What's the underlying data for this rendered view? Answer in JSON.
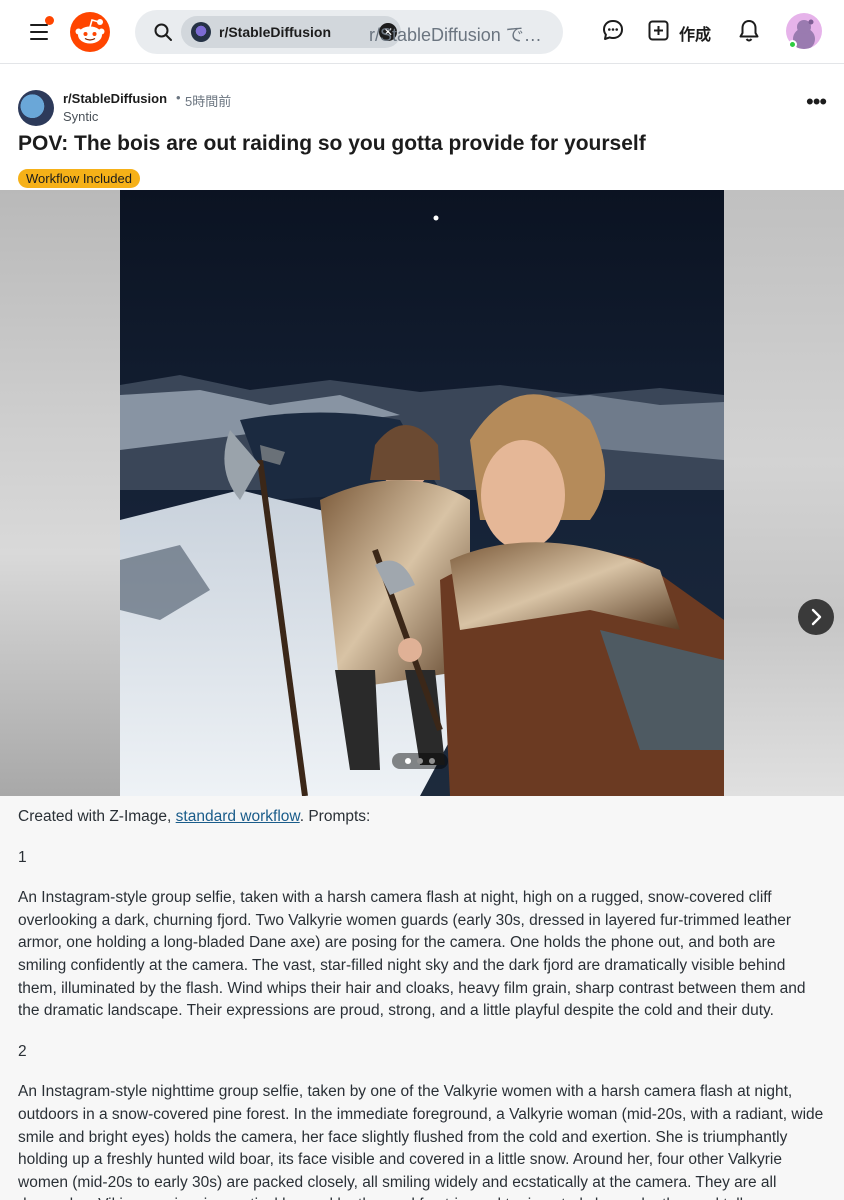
{
  "header": {
    "search": {
      "community_chip": "r/StableDiffusion",
      "placeholder": "r/StableDiffusion で検索"
    },
    "create_label": "作成",
    "icons": [
      "menu-icon",
      "reddit-logo-icon",
      "search-icon",
      "close-icon",
      "chat-icon",
      "plus-icon",
      "bell-icon",
      "avatar"
    ]
  },
  "post": {
    "subreddit": "r/StableDiffusion",
    "separator": "•",
    "time": "5時間前",
    "author": "Syntic",
    "title": "POV: The bois are out raiding so you gotta provide for yourself",
    "flair": "Workflow Included",
    "flair_color": "#f6b118",
    "gallery": {
      "current_index": 1,
      "total": 3
    },
    "body": {
      "intro_prefix": "Created with Z-Image, ",
      "intro_link": "standard workflow",
      "intro_suffix": ". Prompts:",
      "prompt1_number": "1",
      "prompt1_text": "An Instagram-style group selfie, taken with a harsh camera flash at night, high on a rugged, snow-covered cliff overlooking a dark, churning fjord. Two Valkyrie women guards (early 30s, dressed in layered fur-trimmed leather armor, one holding a long-bladed Dane axe) are posing for the camera. One holds the phone out, and both are smiling confidently at the camera. The vast, star-filled night sky and the dark fjord are dramatically visible behind them, illuminated by the flash. Wind whips their hair and cloaks, heavy film grain, sharp contrast between them and the dramatic landscape. Their expressions are proud, strong, and a little playful despite the cold and their duty.",
      "prompt2_number": "2",
      "prompt2_text": "An Instagram-style nighttime group selfie, taken by one of the Valkyrie women with a harsh camera flash at night, outdoors in a snow-covered pine forest. In the immediate foreground, a Valkyrie woman (mid-20s, with a radiant, wide smile and bright eyes) holds the camera, her face slightly flushed from the cold and exertion. She is triumphantly holding up a freshly hunted wild boar, its face visible and covered in a little snow. Around her, four other Valkyrie women (mid-20s to early 30s) are packed closely, all smiling widely and ecstatically at the camera. They are all dressed as Viking warriors in practical layered leather and fur, trimmed to ring-studs brown leather and tall"
    }
  },
  "colors": {
    "accent": "#ff4500",
    "link": "#1a5c8a"
  }
}
